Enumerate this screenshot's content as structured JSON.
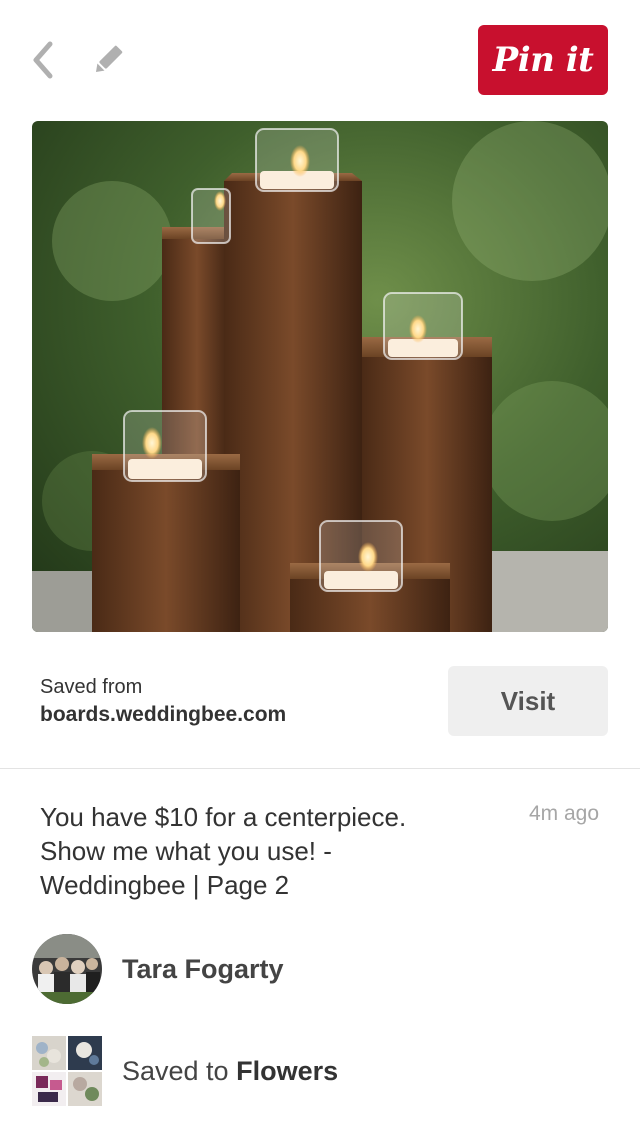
{
  "header": {
    "back_icon": "chevron-left-icon",
    "edit_icon": "pencil-icon",
    "pin_it_label": "Pin it",
    "brand_color": "#c8102e"
  },
  "pin": {
    "image_description_icon": "candle-centerpiece-photo"
  },
  "source": {
    "label": "Saved from",
    "domain": "boards.weddingbee.com",
    "visit_label": "Visit"
  },
  "details": {
    "description": "You have $10 for a centerpiece. Show me what you use! - Weddingbee | Page 2",
    "timestamp": "4m ago"
  },
  "pinner": {
    "name": "Tara Fogarty",
    "avatar_icon": "avatar-icon"
  },
  "board": {
    "prefix": "Saved to ",
    "name": "Flowers",
    "thumb_icon": "board-collage-icon"
  }
}
